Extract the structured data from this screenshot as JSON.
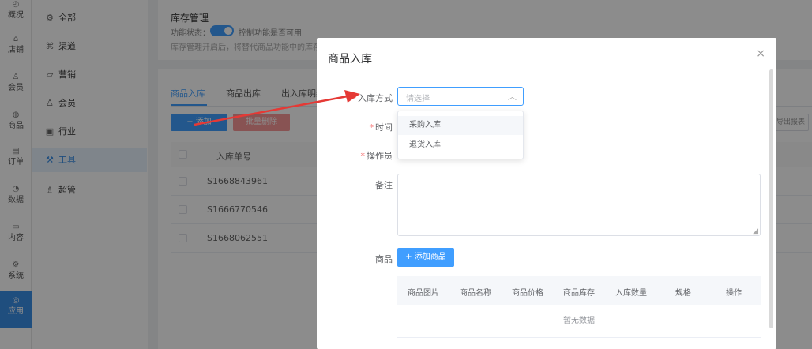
{
  "rail": {
    "items": [
      {
        "label": "概况",
        "icon": "dashboard-icon"
      },
      {
        "label": "店铺",
        "icon": "store-icon"
      },
      {
        "label": "会员",
        "icon": "user-icon"
      },
      {
        "label": "商品",
        "icon": "goods-icon"
      },
      {
        "label": "订单",
        "icon": "order-icon"
      },
      {
        "label": "数据",
        "icon": "chart-icon"
      },
      {
        "label": "内容",
        "icon": "content-icon"
      },
      {
        "label": "系统",
        "icon": "settings-icon"
      },
      {
        "label": "应用",
        "icon": "app-icon"
      }
    ]
  },
  "menu2": {
    "items": [
      {
        "label": "全部",
        "icon": "gear-icon"
      },
      {
        "label": "渠道",
        "icon": "channel-icon"
      },
      {
        "label": "营销",
        "icon": "marketing-icon"
      },
      {
        "label": "会员",
        "icon": "user-icon"
      },
      {
        "label": "行业",
        "icon": "industry-icon"
      },
      {
        "label": "工具",
        "icon": "tool-icon"
      },
      {
        "label": "超管",
        "icon": "admin-icon"
      }
    ]
  },
  "inventory": {
    "title": "库存管理",
    "func_label": "功能状态：",
    "func_desc": "控制功能是否可用",
    "note": "库存管理开启后，将替代商品功能中的库存管"
  },
  "tabs": [
    "商品入库",
    "商品出库",
    "出入库明细"
  ],
  "toolbar": {
    "add": "+ 添加",
    "batch_delete": "批量删除",
    "right_btn": "导出报表"
  },
  "table": {
    "header_order": "入库单号",
    "rows": [
      "S1668843961",
      "S1666770546",
      "S1668062551"
    ]
  },
  "dialog": {
    "title": "商品入库",
    "close": "×",
    "fields": {
      "method_label": "入库方式",
      "time_label": "时间",
      "operator_label": "操作员",
      "remark_label": "备注",
      "goods_label": "商品"
    },
    "select_placeholder": "请选择",
    "options": [
      "采购入库",
      "退货入库"
    ],
    "add_goods": "+ 添加商品",
    "goods_columns": [
      "商品图片",
      "商品名称",
      "商品价格",
      "商品库存",
      "入库数量",
      "规格",
      "操作"
    ],
    "empty": "暂无数据"
  },
  "colors": {
    "primary": "#409eff",
    "danger_light": "#f89898",
    "arrow": "#e53935",
    "required": "#f56c6c"
  }
}
